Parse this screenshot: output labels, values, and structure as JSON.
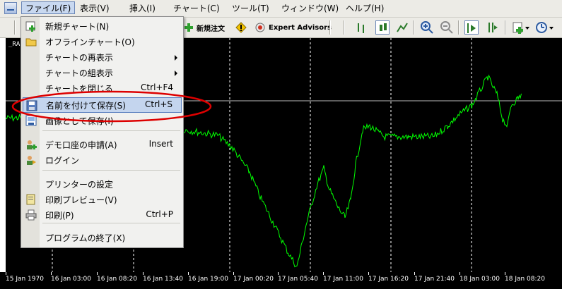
{
  "menubar": {
    "items": [
      "ファイル(F)",
      "表示(V)",
      "挿入(I)",
      "チャート(C)",
      "ツール(T)",
      "ウィンドウ(W)",
      "ヘルプ(H)"
    ]
  },
  "toolbar": {
    "new_order": "新規注文",
    "expert_advisors": "Expert Advisors"
  },
  "chart": {
    "symbol": "_RA",
    "colors": {
      "background": "#000000",
      "price_line": "#00ff00",
      "grid": "#ffffff",
      "callout": "#dd0000"
    }
  },
  "chart_data": {
    "type": "line",
    "x_ticks": [
      "15 Jan 1970",
      "16 Jan 03:00",
      "16 Jan 08:20",
      "16 Jan 13:40",
      "16 Jan 19:00",
      "17 Jan 00:20",
      "17 Jan 05:40",
      "17 Jan 11:00",
      "17 Jan 16:20",
      "17 Jan 21:40",
      "18 Jan 03:00",
      "18 Jan 08:20"
    ],
    "grid": true,
    "series": [
      {
        "color": "#00ff00"
      }
    ]
  },
  "file_menu": {
    "items": [
      {
        "label": "新規チャート(N)",
        "shortcut": "",
        "submenu": false,
        "icon": "new-chart-icon"
      },
      {
        "label": "オフラインチャート(O)",
        "shortcut": "",
        "submenu": false,
        "icon": "folder-icon"
      },
      {
        "label": "チャートの再表示",
        "shortcut": "",
        "submenu": true,
        "icon": ""
      },
      {
        "label": "チャートの組表示",
        "shortcut": "",
        "submenu": true,
        "icon": ""
      },
      {
        "label": "チャートを閉じる",
        "shortcut": "Ctrl+F4",
        "submenu": false,
        "icon": ""
      },
      {
        "label": "名前を付けて保存(S)",
        "shortcut": "Ctrl+S",
        "submenu": false,
        "icon": "save-icon",
        "highlighted": true
      },
      {
        "label": "画像として保存(I)",
        "shortcut": "",
        "submenu": false,
        "icon": "save-image-icon"
      },
      {
        "label": "デモ口座の申請(A)",
        "shortcut": "Insert",
        "submenu": false,
        "icon": "demo-account-icon"
      },
      {
        "label": "ログイン",
        "shortcut": "",
        "submenu": false,
        "icon": "login-icon"
      },
      {
        "label": "プリンターの設定",
        "shortcut": "",
        "submenu": false,
        "icon": ""
      },
      {
        "label": "印刷プレビュー(V)",
        "shortcut": "",
        "submenu": false,
        "icon": "print-preview-icon"
      },
      {
        "label": "印刷(P)",
        "shortcut": "Ctrl+P",
        "submenu": false,
        "icon": "printer-icon"
      },
      {
        "label": "プログラムの終了(X)",
        "shortcut": "",
        "submenu": false,
        "icon": ""
      }
    ]
  }
}
